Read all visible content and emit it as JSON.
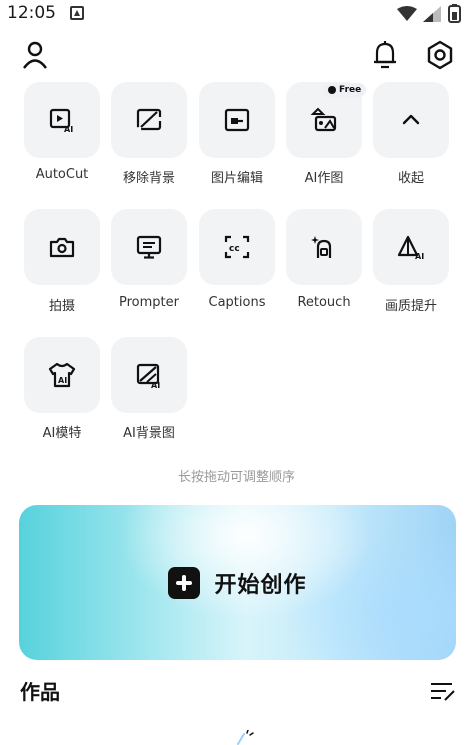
{
  "status_bar": {
    "time": "12:05",
    "icons": [
      "notification-icon",
      "wifi-icon",
      "signal-icon",
      "battery-icon"
    ]
  },
  "topbar": {
    "icons": [
      "profile-icon",
      "bell-icon",
      "settings-icon"
    ]
  },
  "tools": [
    {
      "label": "AutoCut",
      "icon": "autocut-icon"
    },
    {
      "label": "移除背景",
      "icon": "remove-background-icon"
    },
    {
      "label": "图片编辑",
      "icon": "image-edit-icon"
    },
    {
      "label": "AI作图",
      "icon": "ai-draw-icon",
      "badge": "Free"
    },
    {
      "label": "收起",
      "icon": "chevron-up-icon"
    },
    {
      "label": "拍摄",
      "icon": "camera-icon"
    },
    {
      "label": "Prompter",
      "icon": "prompter-icon"
    },
    {
      "label": "Captions",
      "icon": "captions-icon"
    },
    {
      "label": "Retouch",
      "icon": "retouch-icon"
    },
    {
      "label": "画质提升",
      "icon": "quality-boost-icon"
    },
    {
      "label": "AI模特",
      "icon": "ai-model-icon"
    },
    {
      "label": "AI背景图",
      "icon": "ai-background-icon"
    }
  ],
  "hint": "长按拖动可调整顺序",
  "create": {
    "label": "开始创作"
  },
  "works": {
    "title": "作品"
  },
  "colors": {
    "tile_bg": "#f2f3f5",
    "text": "#111111",
    "hint": "#9a9a9a",
    "gradient_left": "#56d2dc",
    "gradient_right": "#9fd4f6"
  }
}
